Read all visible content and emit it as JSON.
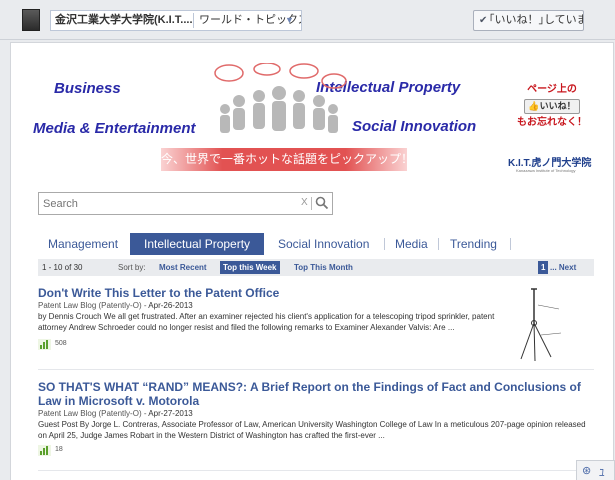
{
  "header": {
    "org_name": "金沢工業大学大学院(K.I.T....",
    "page_tab": "ワールド・トピックス",
    "liked_label": "｢いいね！｣しています"
  },
  "banner": {
    "business": "Business",
    "intellectual_property": "Intellectual Property",
    "media_entertainment": "Media & Entertainment",
    "social_innovation": "Social Innovation",
    "strip_text": "今、世界で一番ホットな話題をピックアップ！",
    "promo_top": "ページ上の",
    "promo_button": "いいね！",
    "promo_bottom": "もお忘れなく！",
    "kit_logo": "K.I.T.虎ノ門大学院",
    "kit_sub": "Kanazawa Institute of Technology"
  },
  "search": {
    "placeholder": "Search",
    "clear": "X"
  },
  "tabs": [
    "Management",
    "Intellectual Property",
    "Social Innovation",
    "Media",
    "Trending"
  ],
  "results": {
    "count": "1 - 10 of 30",
    "sort_by": "Sort by:",
    "sorts": [
      "Most Recent",
      "Top this Week",
      "Top This Month"
    ],
    "page": "1",
    "next": "... Next"
  },
  "articles": [
    {
      "title": "Don't Write This Letter to the Patent Office",
      "source": "Patent Law Blog (Patently-O)",
      "date": "Apr-26-2013",
      "body": "by Dennis Crouch We all get frustrated. After an examiner rejected his client's application for a telescoping tripod sprinkler, patent attorney Andrew Schroeder could no longer resist and filed the following remarks to Examiner Alexander Valvis: Are ...",
      "shares": "508"
    },
    {
      "title": "SO THAT'S WHAT “RAND” MEANS?: A Brief Report on the Findings of Fact and Conclusions of Law in Microsoft v. Motorola",
      "source": "Patent Law Blog (Patently-O)",
      "date": "Apr-27-2013",
      "body": "Guest Post By Jorge L. Contreras, Associate Professor of Law, American University Washington College of Law In a meticulous 207-page opinion released on April 25, Judge James Robart in the Western District of Washington has crafted the first-ever ...",
      "shares": "18"
    }
  ],
  "colors": {
    "accent": "#3b5998",
    "banner_text": "#2a2aa8",
    "strip": "#e25252",
    "promo": "#c8161d"
  }
}
